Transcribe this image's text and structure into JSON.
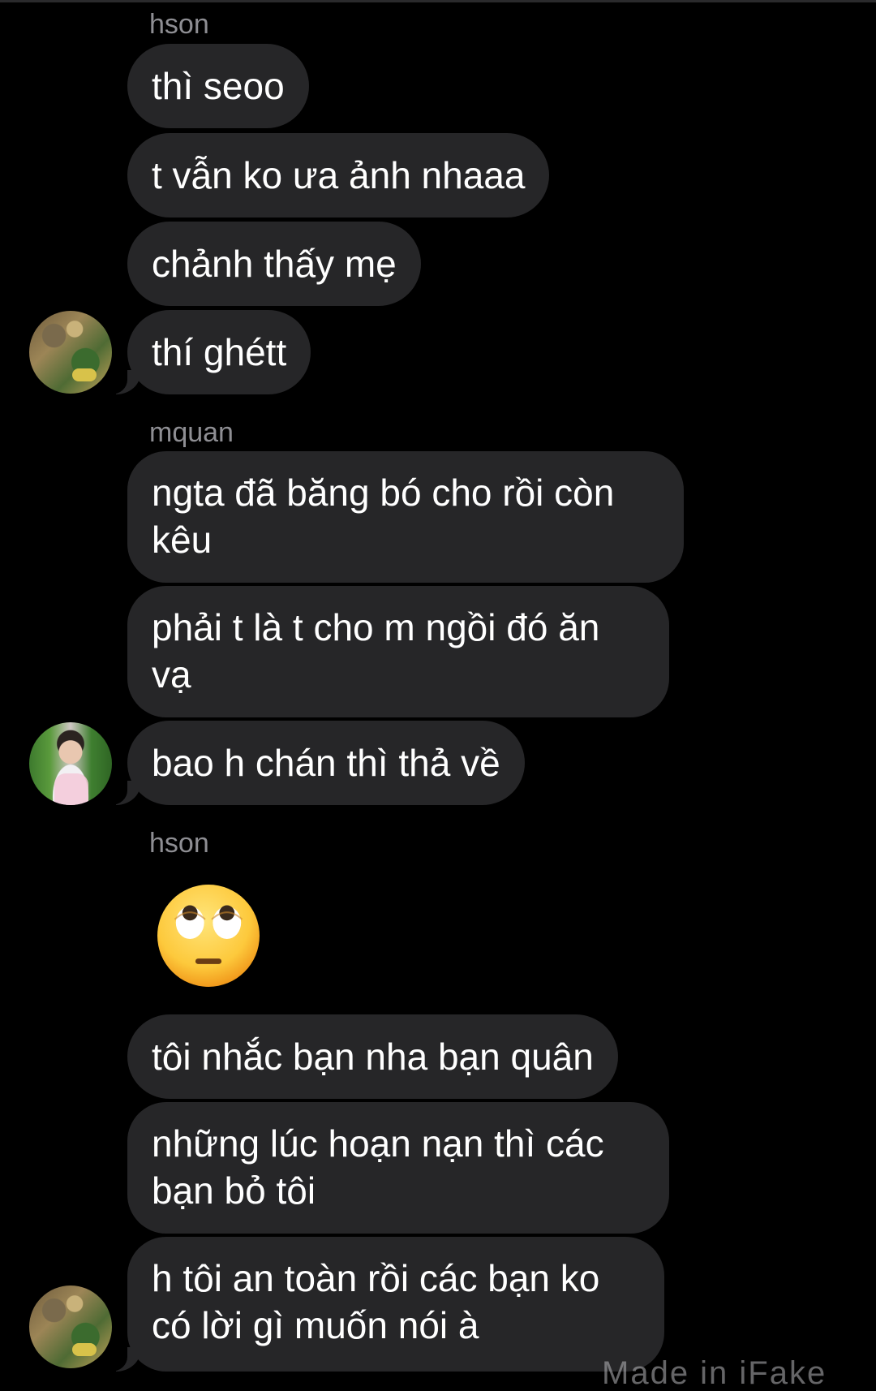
{
  "colors": {
    "background": "#000000",
    "bubble": "#262628",
    "sender_label": "#8e8e93",
    "text": "#ffffff"
  },
  "messages": [
    {
      "sender": "hson",
      "text": "thì seoo"
    },
    {
      "sender": "hson",
      "text": "t vẫn ko ưa ảnh nhaaa"
    },
    {
      "sender": "hson",
      "text": "chảnh thấy mẹ"
    },
    {
      "sender": "hson",
      "text": "thí ghétt"
    },
    {
      "sender": "mquan",
      "text": "ngta đã băng bó cho rồi còn kêu"
    },
    {
      "sender": "mquan",
      "text": "phải t là t cho m ngồi đó ăn vạ"
    },
    {
      "sender": "mquan",
      "text": "bao h chán thì thả về"
    },
    {
      "sender": "hson",
      "emoji": "face-with-rolling-eyes-icon"
    },
    {
      "sender": "hson",
      "text": "tôi nhắc bạn nha bạn quân"
    },
    {
      "sender": "hson",
      "text": "những lúc hoạn nạn thì các bạn bỏ tôi"
    },
    {
      "sender": "hson",
      "text": "h tôi an toàn rồi các bạn ko có lời gì muốn nói à"
    }
  ],
  "groups": [
    {
      "sender_name": "hson"
    },
    {
      "sender_name": "mquan"
    },
    {
      "sender_name": "hson"
    }
  ],
  "watermark": "Made in iFake"
}
